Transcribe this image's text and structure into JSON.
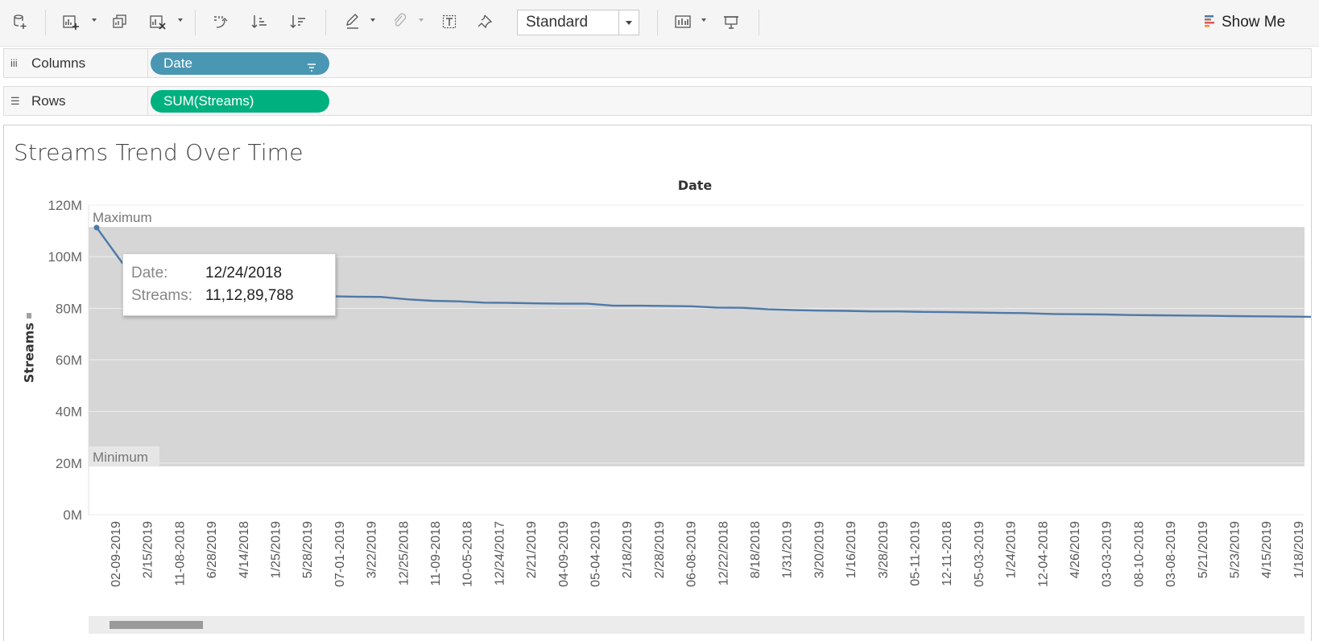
{
  "toolbar": {
    "mark_size": "Standard",
    "show_me": "Show Me",
    "icons": [
      "new-data-source-icon",
      "new-worksheet-icon",
      "duplicate-sheet-icon",
      "clear-sheet-icon",
      "swap-rows-columns-icon",
      "sort-ascending-icon",
      "sort-descending-icon",
      "highlight-icon",
      "group-icon",
      "show-labels-icon",
      "pin-axis-icon",
      "show-card-icon",
      "presentation-mode-icon"
    ]
  },
  "shelves": {
    "columns_label": "Columns",
    "rows_label": "Rows",
    "columns_pill": "Date",
    "rows_pill": "SUM(Streams)"
  },
  "worksheet": {
    "title": "Streams Trend Over Time",
    "column_header": "Date",
    "y_axis_title": "Streams"
  },
  "tooltip": {
    "date_label": "Date:",
    "date_value": "12/24/2018",
    "streams_label": "Streams:",
    "streams_value": "11,12,89,788"
  },
  "chart_data": {
    "type": "line",
    "title": "Streams Trend Over Time",
    "xlabel": "Date",
    "ylabel": "Streams",
    "ylim": [
      0,
      120000000
    ],
    "y_ticks": [
      "0M",
      "20M",
      "40M",
      "60M",
      "80M",
      "100M",
      "120M"
    ],
    "y_tick_values": [
      0,
      20000000,
      40000000,
      60000000,
      80000000,
      100000000,
      120000000
    ],
    "grid": true,
    "reference_band": {
      "min": 19000000,
      "max": 111289788,
      "max_label": "Maximum",
      "min_label": "Minimum"
    },
    "x_tick_labels": [
      "02-09-2019",
      "2/15/2019",
      "11-08-2018",
      "6/28/2019",
      "4/14/2018",
      "1/25/2019",
      "5/28/2019",
      "07-01-2019",
      "3/22/2019",
      "12/25/2018",
      "11-09-2018",
      "10-05-2018",
      "12/24/2017",
      "2/21/2019",
      "04-09-2019",
      "05-04-2019",
      "2/18/2019",
      "2/28/2019",
      "06-08-2019",
      "12/22/2018",
      "8/18/2018",
      "1/31/2019",
      "3/20/2019",
      "1/16/2019",
      "3/28/2019",
      "05-11-2019",
      "12-11-2018",
      "05-03-2019",
      "1/24/2019",
      "12-04-2018",
      "4/26/2019",
      "03-03-2019",
      "08-10-2018",
      "03-08-2019",
      "5/21/2019",
      "5/23/2019",
      "4/15/2019",
      "1/18/2019"
    ],
    "series": [
      {
        "color": "#4e79a7",
        "values": [
          111289788,
          97500000,
          94000000,
          90500000,
          88000000,
          86500000,
          86000000,
          85300000,
          84800000,
          84700000,
          84500000,
          84400000,
          83500000,
          82900000,
          82700000,
          82200000,
          82100000,
          81900000,
          81800000,
          81800000,
          81000000,
          81000000,
          80900000,
          80800000,
          80300000,
          80200000,
          79600000,
          79300000,
          79100000,
          79000000,
          78800000,
          78800000,
          78600000,
          78500000,
          78400000,
          78200000,
          78100000,
          77800000,
          77700000,
          77600000,
          77400000,
          77300000,
          77200000,
          77100000,
          77000000,
          76900000,
          76800000,
          76700000
        ]
      }
    ]
  }
}
